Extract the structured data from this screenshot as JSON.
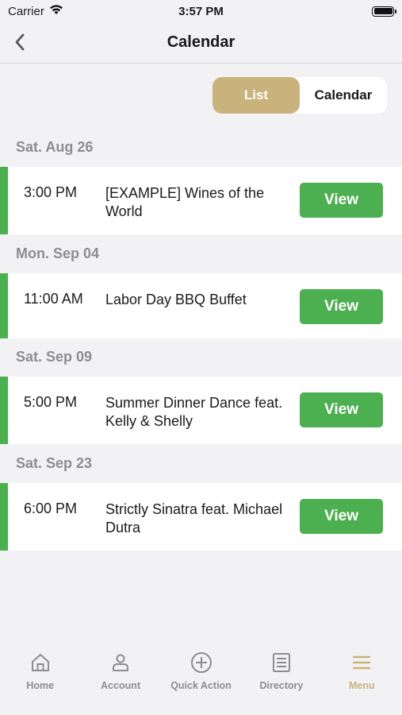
{
  "status_bar": {
    "carrier": "Carrier",
    "time": "3:57 PM"
  },
  "nav": {
    "title": "Calendar"
  },
  "segment": {
    "list_label": "List",
    "calendar_label": "Calendar",
    "selected": "List"
  },
  "events": [
    {
      "date": "Sat. Aug 26",
      "time": "3:00 PM",
      "title": "[EXAMPLE] Wines of the World",
      "button": "View"
    },
    {
      "date": "Mon. Sep 04",
      "time": "11:00 AM",
      "title": "Labor Day BBQ Buffet",
      "button": "View"
    },
    {
      "date": "Sat. Sep 09",
      "time": "5:00 PM",
      "title": "Summer Dinner Dance feat. Kelly & Shelly",
      "button": "View"
    },
    {
      "date": "Sat. Sep 23",
      "time": "6:00 PM",
      "title": "Strictly Sinatra feat. Michael Dutra",
      "button": "View"
    }
  ],
  "tabs": [
    {
      "label": "Home",
      "icon": "home-icon"
    },
    {
      "label": "Account",
      "icon": "person-icon"
    },
    {
      "label": "Quick Action",
      "icon": "plus-circle-icon"
    },
    {
      "label": "Directory",
      "icon": "directory-icon"
    },
    {
      "label": "Menu",
      "icon": "menu-icon",
      "active": true
    }
  ],
  "colors": {
    "accent_gold": "#c9b27c",
    "green": "#4caf50",
    "muted": "#8c8c92",
    "background": "#f2f2f5"
  }
}
